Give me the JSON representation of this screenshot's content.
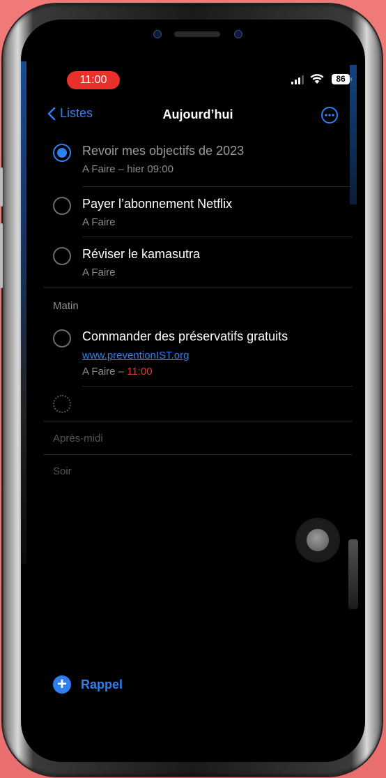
{
  "status_bar": {
    "time": "11:00",
    "battery": "86"
  },
  "nav": {
    "back_label": "Listes",
    "title": "Aujourd’hui"
  },
  "tasks": [
    {
      "title": "Revoir mes objectifs de 2023",
      "subtitle": "A Faire – hier 09:00",
      "completed": true
    },
    {
      "title": "Payer l’abonnement Netflix",
      "subtitle": "A Faire",
      "completed": false
    },
    {
      "title": "Réviser le kamasutra",
      "subtitle": "A Faire",
      "completed": false
    }
  ],
  "sections": {
    "morning": {
      "label": "Matin",
      "task": {
        "title": "Commander des préservatifs gratuits",
        "link": "www.preventionIST.org",
        "subtitle_prefix": "A Faire – ",
        "time": "11:00"
      }
    },
    "afternoon": {
      "label": "Après-midi"
    },
    "evening": {
      "label": "Soir"
    }
  },
  "footer": {
    "add_label": "Rappel"
  },
  "colors": {
    "accent": "#2f7ff0",
    "status_red": "#e9302b",
    "background": "#000000"
  }
}
